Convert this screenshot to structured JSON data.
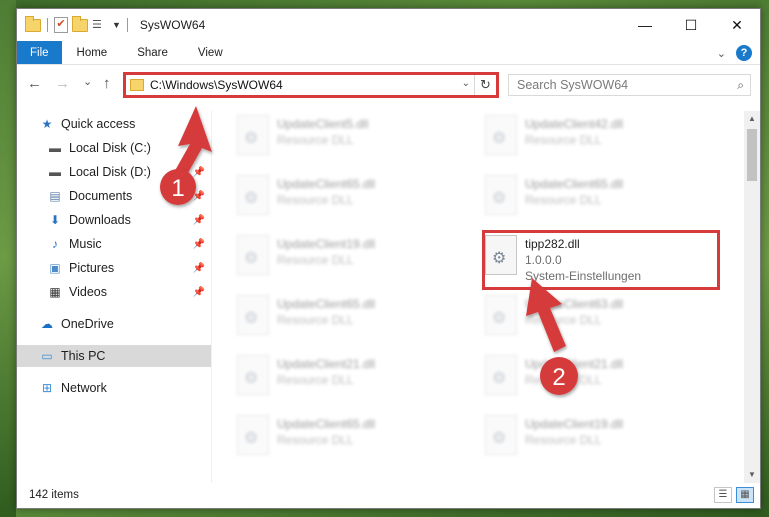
{
  "titlebar": {
    "title": "SysWOW64",
    "minimize": "—",
    "maximize": "☐",
    "close": "✕"
  },
  "ribbon": {
    "tabs": [
      "File",
      "Home",
      "Share",
      "View"
    ],
    "expand_icon": "chevron-down-icon",
    "help": "?"
  },
  "navigation": {
    "back": "←",
    "forward": "→",
    "up_recent": "⌄",
    "up": "↑",
    "address": "C:\\Windows\\SysWOW64",
    "refresh": "↻",
    "search_placeholder": "Search SysWOW64"
  },
  "sidebar": {
    "items": [
      {
        "label": "Quick access",
        "icon": "star-icon",
        "pinned": false
      },
      {
        "label": "Local Disk (C:)",
        "icon": "drive-icon",
        "pinned": true
      },
      {
        "label": "Local Disk (D:)",
        "icon": "drive-icon",
        "pinned": true
      },
      {
        "label": "Documents",
        "icon": "documents-icon",
        "pinned": true
      },
      {
        "label": "Downloads",
        "icon": "downloads-icon",
        "pinned": true
      },
      {
        "label": "Music",
        "icon": "music-icon",
        "pinned": true
      },
      {
        "label": "Pictures",
        "icon": "pictures-icon",
        "pinned": true
      },
      {
        "label": "Videos",
        "icon": "videos-icon",
        "pinned": true
      },
      {
        "label": "OneDrive",
        "icon": "cloud-icon",
        "pinned": false
      },
      {
        "label": "This PC",
        "icon": "computer-icon",
        "pinned": false,
        "selected": true
      },
      {
        "label": "Network",
        "icon": "network-icon",
        "pinned": false
      }
    ]
  },
  "files": [
    {
      "name": "UpdateClient5.dll",
      "sub": "Resource DLL"
    },
    {
      "name": "UpdateClient42.dll",
      "sub": "Resource DLL"
    },
    {
      "name": "UpdateClient65.dll",
      "sub": "Resource DLL"
    },
    {
      "name": "UpdateClient65.dll",
      "sub": "Resource DLL"
    },
    {
      "name": "UpdateClient19.dll",
      "sub": "Resource DLL"
    },
    {
      "name": "tipp282.dll",
      "sub": "1.0.0.0",
      "sub2": "System-Einstellungen",
      "highlighted": true
    },
    {
      "name": "UpdateClient65.dll",
      "sub": "Resource DLL"
    },
    {
      "name": "UpdateClient63.dll",
      "sub": "Resource DLL"
    },
    {
      "name": "UpdateClient21.dll",
      "sub": "Resource DLL"
    },
    {
      "name": "UpdateClient21.dll",
      "sub": "Resource DLL"
    },
    {
      "name": "UpdateClient65.dll",
      "sub": "Resource DLL"
    },
    {
      "name": "UpdateClient19.dll",
      "sub": "Resource DLL"
    }
  ],
  "status": {
    "count": "142 items"
  },
  "annotations": {
    "step1": "1",
    "step2": "2",
    "color": "#d63a3a"
  }
}
